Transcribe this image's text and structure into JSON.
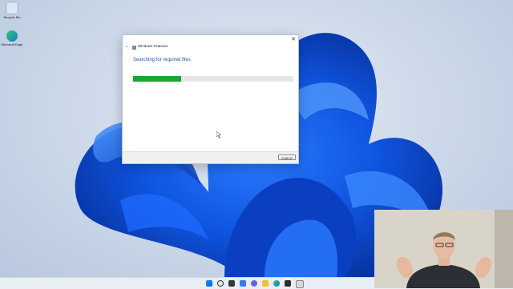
{
  "desktop": {
    "icons": [
      {
        "name": "recycle-bin-icon",
        "label": "Recycle Bin"
      },
      {
        "name": "edge-icon",
        "label": "Microsoft Edge"
      }
    ]
  },
  "dialog": {
    "title": "Windows Features",
    "heading": "Searching for required files",
    "progress": 0.3,
    "cancel_label": "Cancel",
    "close_glyph": "✕",
    "back_glyph": "←"
  },
  "taskbar": {
    "icons": [
      "windows-start-icon",
      "search-icon",
      "task-view-icon",
      "widgets-icon",
      "chat-icon",
      "file-explorer-icon",
      "edge-icon",
      "store-icon",
      "app-icon"
    ]
  },
  "colors": {
    "accent": "#1c5aa6",
    "progress": "#1aa534",
    "wallpaper_blue": "#1a5fe0"
  }
}
